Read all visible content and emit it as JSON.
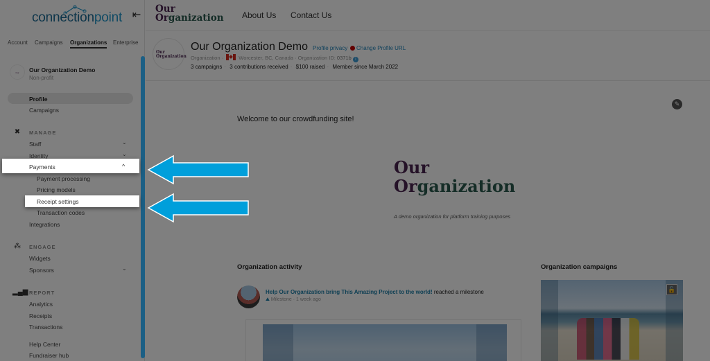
{
  "sidebar": {
    "logo": {
      "part1": "connection",
      "part2": "point"
    },
    "collapse_icon": "collapse-left-icon",
    "top_tabs": [
      {
        "label": "Account",
        "active": false
      },
      {
        "label": "Campaigns",
        "active": false
      },
      {
        "label": "Organizations",
        "active": true
      },
      {
        "label": "Enterprise",
        "active": false
      }
    ],
    "org": {
      "name": "Our Organization Demo",
      "type": "Non-profit",
      "avatar_text": "Our Organization"
    },
    "items": {
      "profile": "Profile",
      "campaigns": "Campaigns",
      "manage_head": "MANAGE",
      "staff": "Staff",
      "identity": "Identity",
      "payments": "Payments",
      "payment_processing": "Payment processing",
      "pricing_models": "Pricing models",
      "receipt_settings": "Receipt settings",
      "transaction_codes": "Transaction codes",
      "integrations": "Integrations",
      "engage_head": "ENGAGE",
      "widgets": "Widgets",
      "sponsors": "Sponsors",
      "report_head": "REPORT",
      "analytics": "Analytics",
      "receipts": "Receipts",
      "transactions": "Transactions",
      "help_center": "Help Center",
      "fundraiser_hub": "Fundraiser hub"
    },
    "chevron_down": "⌄",
    "chevron_up": "^"
  },
  "header": {
    "logo_line1": "Our",
    "logo_line2a": "Or",
    "logo_line2b": "ganization",
    "nav": [
      "About Us",
      "Contact Us"
    ]
  },
  "profile": {
    "title": "Our Organization Demo",
    "privacy_link": "Profile privacy",
    "change_url_link": "Change Profile URL",
    "type": "Organization",
    "location": "Worcester, BC, Canada",
    "org_id_label": "Organization ID:",
    "org_id": "0371b",
    "stats": [
      "3 campaigns",
      "3 contributions received",
      "$100 raised",
      "Member since March 2022"
    ]
  },
  "content": {
    "welcome": "Welcome to our crowdfunding site!",
    "big_logo_line1": "Our",
    "big_logo_line2a": "Or",
    "big_logo_line2b": "ganization",
    "tagline": "A demo organization for platform training purposes",
    "activity_title": "Organization activity",
    "activity": {
      "link": "Help Our Organization bring This Amazing Project to the world!",
      "suffix": " reached a milestone",
      "type": "Milestone",
      "time": "1 week ago"
    },
    "campaigns_title": "Organization campaigns"
  },
  "colors": {
    "arrow": "#009fdb",
    "accent": "#1b5f85",
    "overlay": "rgba(0,0,0,0.5)"
  }
}
